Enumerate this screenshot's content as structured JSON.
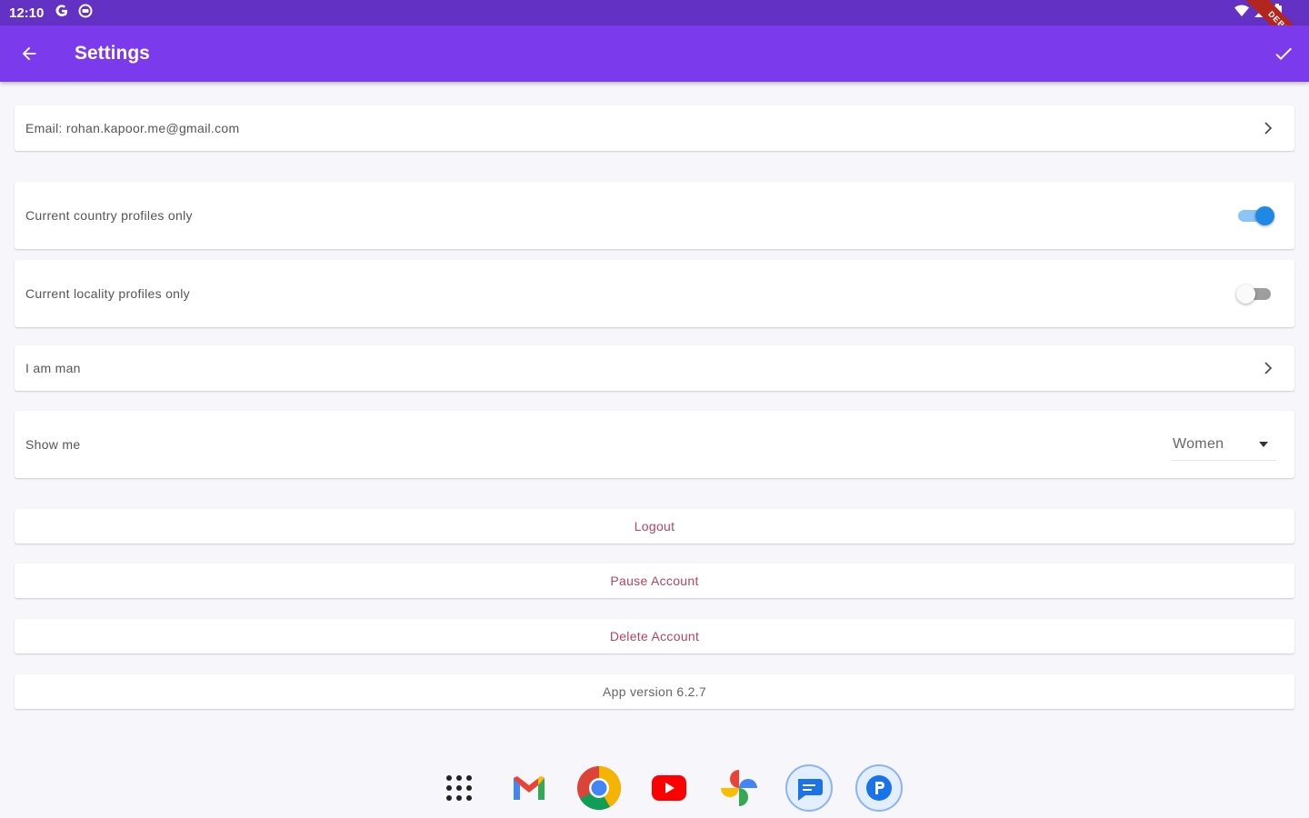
{
  "status_bar": {
    "time": "12:10",
    "left_icons": [
      "google-g-icon",
      "shield-icon"
    ],
    "right_icons": [
      "wifi-icon",
      "signal-icon",
      "battery-icon"
    ]
  },
  "app_bar": {
    "title": "Settings",
    "color": "#7c3aed"
  },
  "settings": {
    "email_label": "Email: rohan.kapoor.me@gmail.com",
    "country_label": "Current country profiles only",
    "country_on": true,
    "locality_label": "Current locality profiles only",
    "locality_on": false,
    "gender_label": "I am man",
    "show_me_label": "Show me",
    "show_me_value": "Women"
  },
  "actions": {
    "logout": "Logout",
    "pause": "Pause Account",
    "delete": "Delete Account",
    "version": "App version 6.2.7"
  },
  "dock": {
    "apps": [
      "app-grid-icon",
      "gmail-icon",
      "chrome-icon",
      "youtube-icon",
      "photos-icon",
      "messages-icon",
      "parking-app-icon"
    ]
  },
  "colors": {
    "accent": "#7c3aed",
    "status_bar": "#6331c4",
    "toggle_on": "#1e88e5",
    "action_text": "#b2455f"
  }
}
